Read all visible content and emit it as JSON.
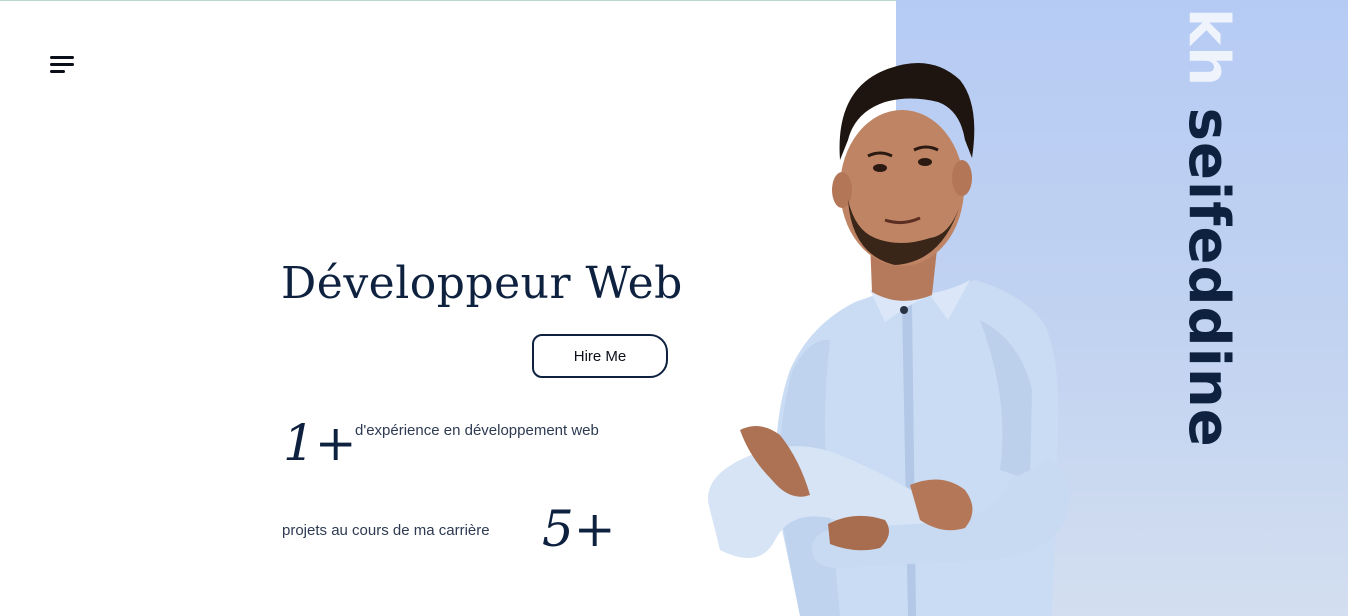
{
  "header": {
    "menu_icon": "hamburger-menu-icon"
  },
  "hero": {
    "title": "Développeur Web",
    "hire_button_label": "Hire Me"
  },
  "stats": [
    {
      "number": "1+",
      "text": "d'expérience en développement web"
    },
    {
      "number": "5+",
      "text": "projets au cours de ma carrière"
    }
  ],
  "profile": {
    "name_part1": "kh",
    "name_part2": "seifeddine"
  },
  "colors": {
    "primary": "#0e2240",
    "panel": "#b6cbf4",
    "name_light": "#eef3fc"
  }
}
